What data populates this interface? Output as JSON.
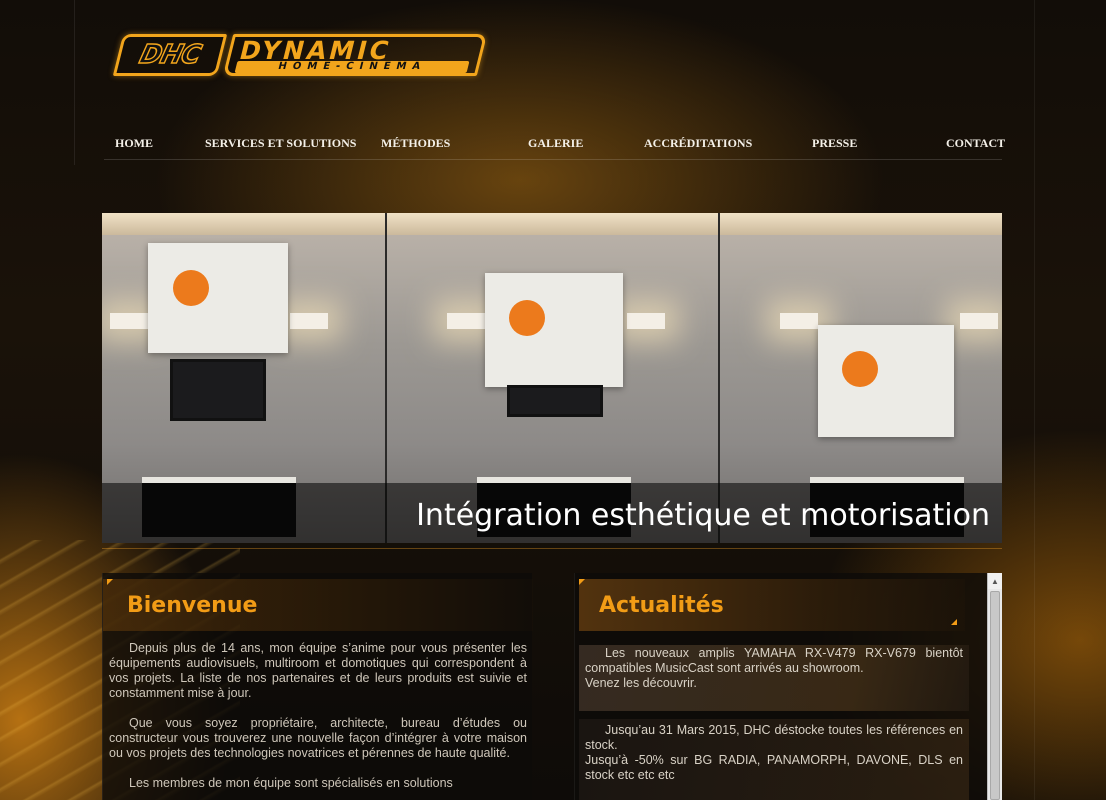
{
  "logo": {
    "mark": "DHC",
    "name": "DYNAMIC",
    "tagline": "HOME-CINEMA"
  },
  "nav": {
    "items": [
      {
        "label": "HOME"
      },
      {
        "label": "SERVICES ET SOLUTIONS"
      },
      {
        "label": "MÉTHODES"
      },
      {
        "label": "GALERIE"
      },
      {
        "label": "ACCRÉDITATIONS"
      },
      {
        "label": "PRESSE"
      },
      {
        "label": "CONTACT"
      }
    ]
  },
  "banner": {
    "caption": "Intégration esthétique et motorisation"
  },
  "welcome": {
    "title": "Bienvenue",
    "paragraphs": [
      "Depuis plus de 14 ans, mon équipe s’anime pour vous présenter les équipements audiovisuels, multiroom et domotiques qui correspondent à vos projets. La liste de nos partenaires et de leurs produits est suivie et constamment mise à jour.",
      "Que vous soyez propriétaire, architecte, bureau d’études ou constructeur vous trouverez une nouvelle façon d’intégrer à votre maison ou vos projets des technologies novatrices et pérennes de haute qualité.",
      "Les membres de mon équipe sont spécialisés en solutions"
    ]
  },
  "news": {
    "title": "Actualités",
    "items": [
      {
        "line1": "Les nouveaux amplis YAMAHA RX-V479 RX-V679 bientôt compatibles MusicCast sont arrivés au showroom.",
        "line2": "Venez les découvrir."
      },
      {
        "line1": "Jusqu’au 31 Mars 2015, DHC déstocke toutes les références en stock.",
        "line2": "Jusqu’à -50% sur BG RADIA, PANAMORPH, DAVONE, DLS en stock etc etc etc"
      }
    ]
  },
  "colors": {
    "accent": "#f29c16",
    "nav_text": "#f4f0e8",
    "body_text": "#cfc7ba"
  }
}
